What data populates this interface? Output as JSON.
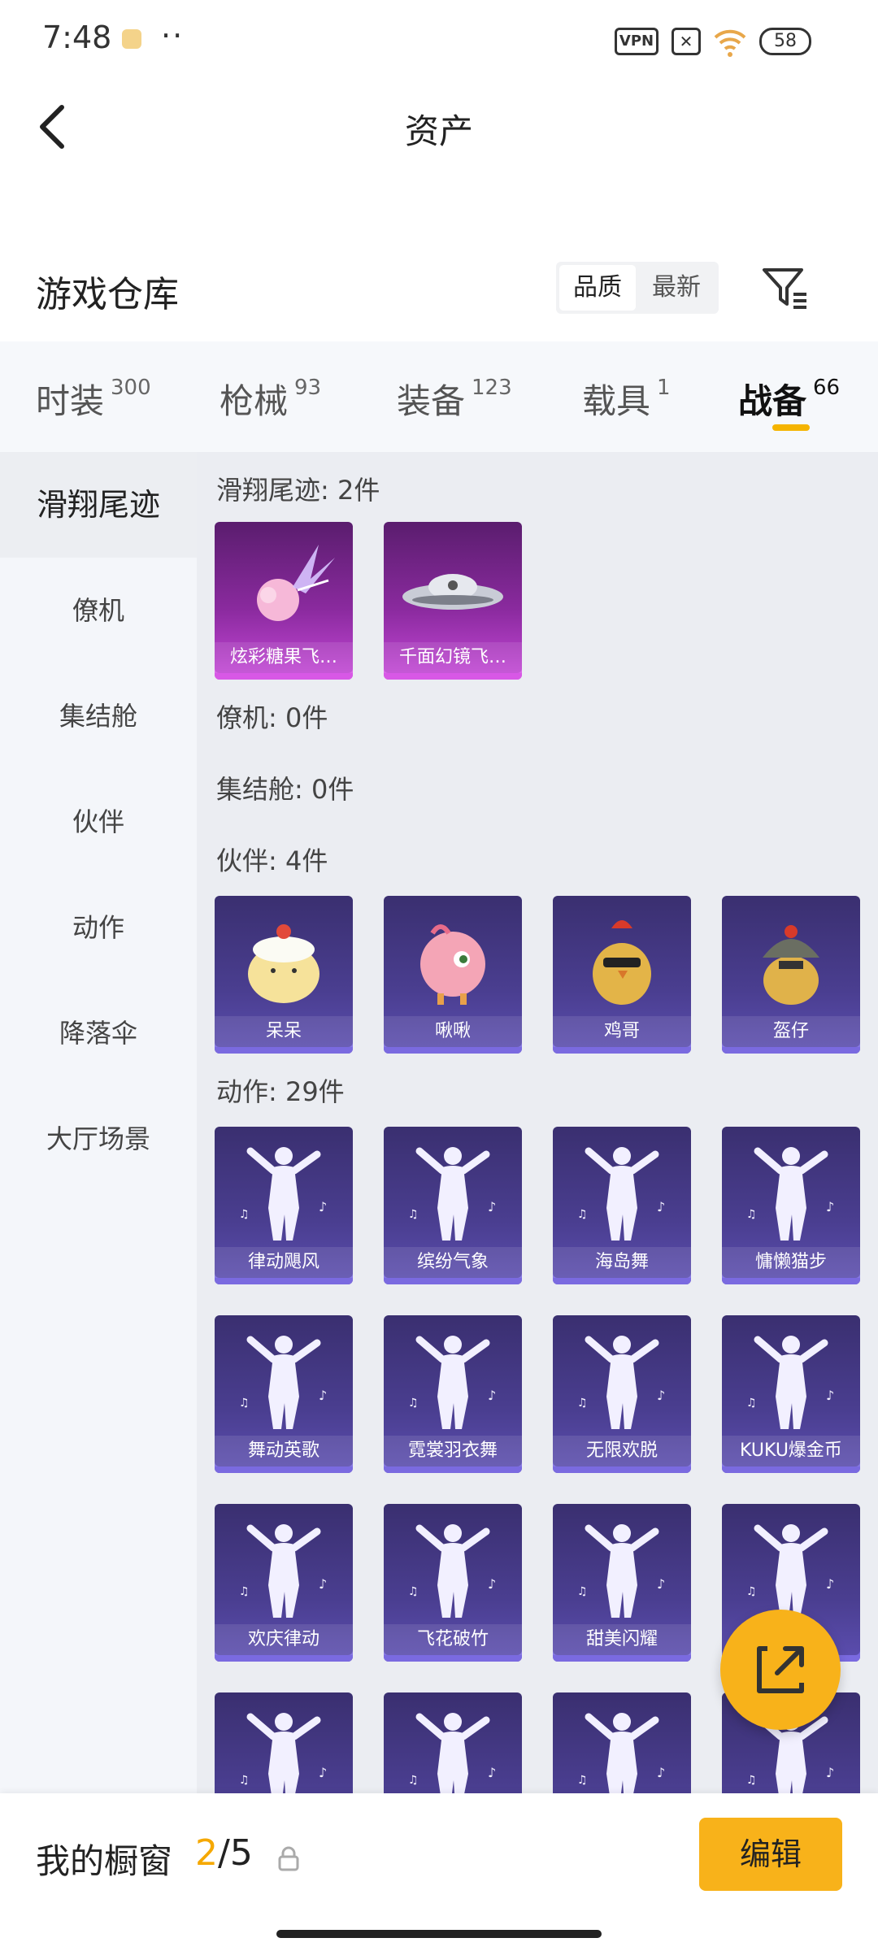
{
  "status_bar": {
    "time": "7:48",
    "dots": "··",
    "vpn": "VPN",
    "battery": "58"
  },
  "header": {
    "title": "资产"
  },
  "warehouse": {
    "title": "游戏仓库",
    "sort_options": [
      "品质",
      "最新"
    ],
    "active_sort": "品质"
  },
  "tabs": [
    {
      "label": "时装",
      "count": "300"
    },
    {
      "label": "枪械",
      "count": "93"
    },
    {
      "label": "装备",
      "count": "123"
    },
    {
      "label": "载具",
      "count": "1"
    },
    {
      "label": "战备",
      "count": "66",
      "active": true
    }
  ],
  "sidebar": {
    "items": [
      "滑翔尾迹",
      "僚机",
      "集结舱",
      "伙伴",
      "动作",
      "降落伞",
      "大厅场景"
    ],
    "active": "滑翔尾迹"
  },
  "sections": {
    "glide": {
      "title": "滑翔尾迹: 2件",
      "items": [
        "炫彩糖果飞…",
        "千面幻镜飞…"
      ]
    },
    "wingman": {
      "title": "僚机: 0件"
    },
    "capsule": {
      "title": "集结舱: 0件"
    },
    "partner": {
      "title": "伙伴: 4件",
      "items": [
        "呆呆",
        "啾啾",
        "鸡哥",
        "盔仔"
      ]
    },
    "emote": {
      "title": "动作: 29件",
      "items": [
        "律动飓风",
        "缤纷气象",
        "海岛舞",
        "慵懒猫步",
        "舞动英歌",
        "霓裳羽衣舞",
        "无限欢脱",
        "KUKU爆金币",
        "欢庆律动",
        "飞花破竹",
        "甜美闪耀",
        "",
        "",
        "",
        "",
        ""
      ]
    }
  },
  "bottom_bar": {
    "label": "我的橱窗",
    "current": "2",
    "total": "/5",
    "edit_label": "编辑"
  },
  "colors": {
    "accent": "#f8b21a",
    "card_purple": "#4a3e90",
    "card_pink": "#c548d8"
  },
  "icons": [
    "back-arrow-icon",
    "filter-icon",
    "lock-icon",
    "share-icon",
    "vpn-icon",
    "wifi-icon",
    "battery-icon"
  ]
}
